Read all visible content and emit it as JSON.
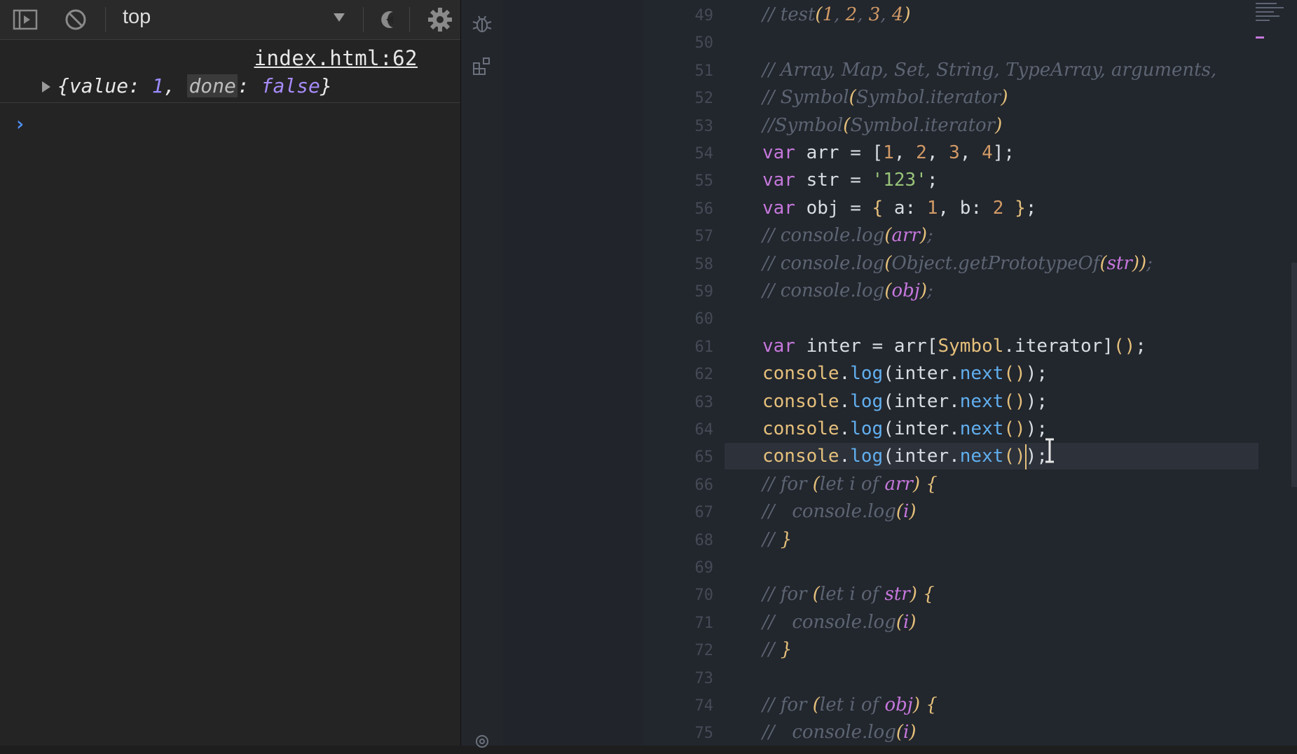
{
  "devtools": {
    "context_label": "top",
    "log_source": "index.html:62",
    "log_entry": {
      "open": "{",
      "value_key": "value",
      "value": "1",
      "comma": ", ",
      "done_key": "done",
      "done": "false",
      "close": "}"
    },
    "icons": [
      "dock-toggle-icon",
      "clear-console-icon",
      "dropdown-arrow-icon",
      "eye-icon",
      "gear-icon"
    ]
  },
  "editor": {
    "current_line": 65,
    "lines": [
      {
        "n": "49",
        "text": "// test(1, 2, 3, 4)"
      },
      {
        "n": "50",
        "text": ""
      },
      {
        "n": "51",
        "text": "// Array, Map, Set, String, TypeArray, arguments,"
      },
      {
        "n": "52",
        "text": "// Symbol(Symbol.iterator)"
      },
      {
        "n": "53",
        "text": "//Symbol(Symbol.iterator)"
      },
      {
        "n": "54",
        "text": "var arr = [1, 2, 3, 4];"
      },
      {
        "n": "55",
        "text": "var str = '123';"
      },
      {
        "n": "56",
        "text": "var obj = { a: 1, b: 2 };"
      },
      {
        "n": "57",
        "text": "// console.log(arr);"
      },
      {
        "n": "58",
        "text": "// console.log(Object.getPrototypeOf(str));"
      },
      {
        "n": "59",
        "text": "// console.log(obj);"
      },
      {
        "n": "60",
        "text": ""
      },
      {
        "n": "61",
        "text": "var inter = arr[Symbol.iterator]();"
      },
      {
        "n": "62",
        "text": "console.log(inter.next());"
      },
      {
        "n": "63",
        "text": "console.log(inter.next());"
      },
      {
        "n": "64",
        "text": "console.log(inter.next());"
      },
      {
        "n": "65",
        "text": "console.log(inter.next());"
      },
      {
        "n": "66",
        "text": "// for (let i of arr) {"
      },
      {
        "n": "67",
        "text": "//   console.log(i)"
      },
      {
        "n": "68",
        "text": "// }"
      },
      {
        "n": "69",
        "text": ""
      },
      {
        "n": "70",
        "text": "// for (let i of str) {"
      },
      {
        "n": "71",
        "text": "//   console.log(i)"
      },
      {
        "n": "72",
        "text": "// }"
      },
      {
        "n": "73",
        "text": ""
      },
      {
        "n": "74",
        "text": "// for (let i of obj) {"
      },
      {
        "n": "75",
        "text": "//   console.log(i)"
      }
    ]
  }
}
